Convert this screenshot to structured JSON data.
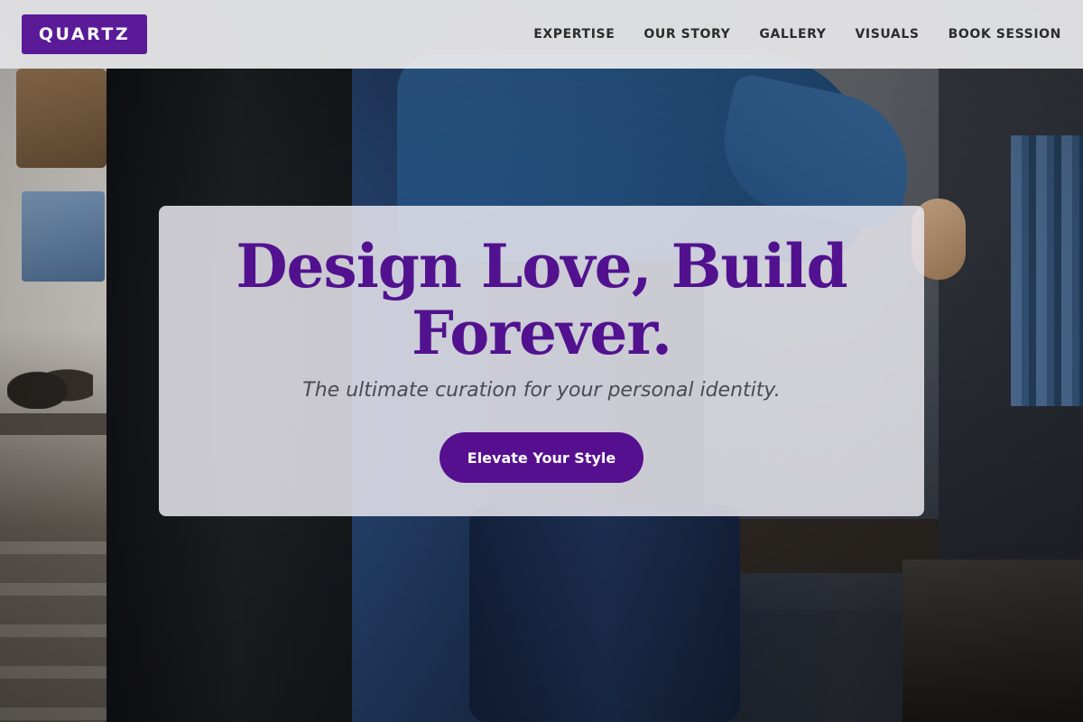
{
  "header": {
    "logo": "QUARTZ",
    "nav": [
      {
        "label": "EXPERTISE"
      },
      {
        "label": "OUR STORY"
      },
      {
        "label": "GALLERY"
      },
      {
        "label": "VISUALS"
      },
      {
        "label": "BOOK SESSION"
      }
    ]
  },
  "hero": {
    "title": "Design Love, Build Forever.",
    "subtitle": "The ultimate curation for your personal identity.",
    "cta": "Elevate Your Style"
  },
  "background": {
    "description_icon": "fashion-store-photo"
  },
  "colors": {
    "brand_purple": "#5b1a98",
    "title_purple": "#52128f",
    "nav_text": "#2c2c2c",
    "header_bg": "#ececee"
  }
}
